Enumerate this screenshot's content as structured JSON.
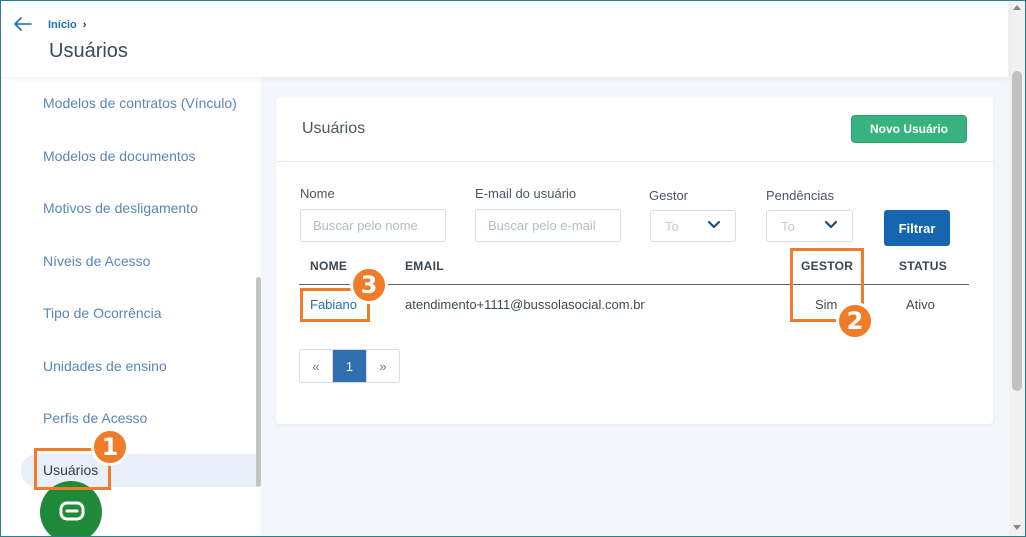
{
  "header": {
    "breadcrumb_home": "Início",
    "breadcrumb_sep": "›",
    "title": "Usuários"
  },
  "sidebar": {
    "items": [
      {
        "label": "Modelos de contratos (Vínculo)"
      },
      {
        "label": "Modelos de documentos"
      },
      {
        "label": "Motivos de desligamento"
      },
      {
        "label": "Níveis de Acesso"
      },
      {
        "label": "Tipo de Ocorrência"
      },
      {
        "label": "Unidades de ensino"
      },
      {
        "label": "Perfis de Acesso"
      },
      {
        "label": "Usuários"
      }
    ],
    "active_index": 7
  },
  "card": {
    "title": "Usuários",
    "new_button": "Novo Usuário"
  },
  "filters": {
    "name_label": "Nome",
    "name_placeholder": "Buscar pelo nome",
    "email_label": "E-mail do usuário",
    "email_placeholder": "Buscar pelo e-mail",
    "gestor_label": "Gestor",
    "gestor_value": "To",
    "pendencias_label": "Pendências",
    "pendencias_value": "To",
    "filter_button": "Filtrar"
  },
  "table": {
    "columns": [
      "NOME",
      "EMAIL",
      "GESTOR",
      "STATUS"
    ],
    "rows": [
      {
        "nome": "Fabiano",
        "email": "atendimento+1111@bussolasocial.com.br",
        "gestor": "Sim",
        "status": "Ativo"
      }
    ]
  },
  "pagination": {
    "prev": "«",
    "current": "1",
    "next": "»"
  },
  "annotations": {
    "badge_1": "1",
    "badge_2": "2",
    "badge_3": "3",
    "color": "#f07c2a"
  },
  "colors": {
    "primary_button": "#1565b0",
    "new_button": "#36b37e",
    "link": "#1e6fb5",
    "chat": "#1f8a3a"
  }
}
